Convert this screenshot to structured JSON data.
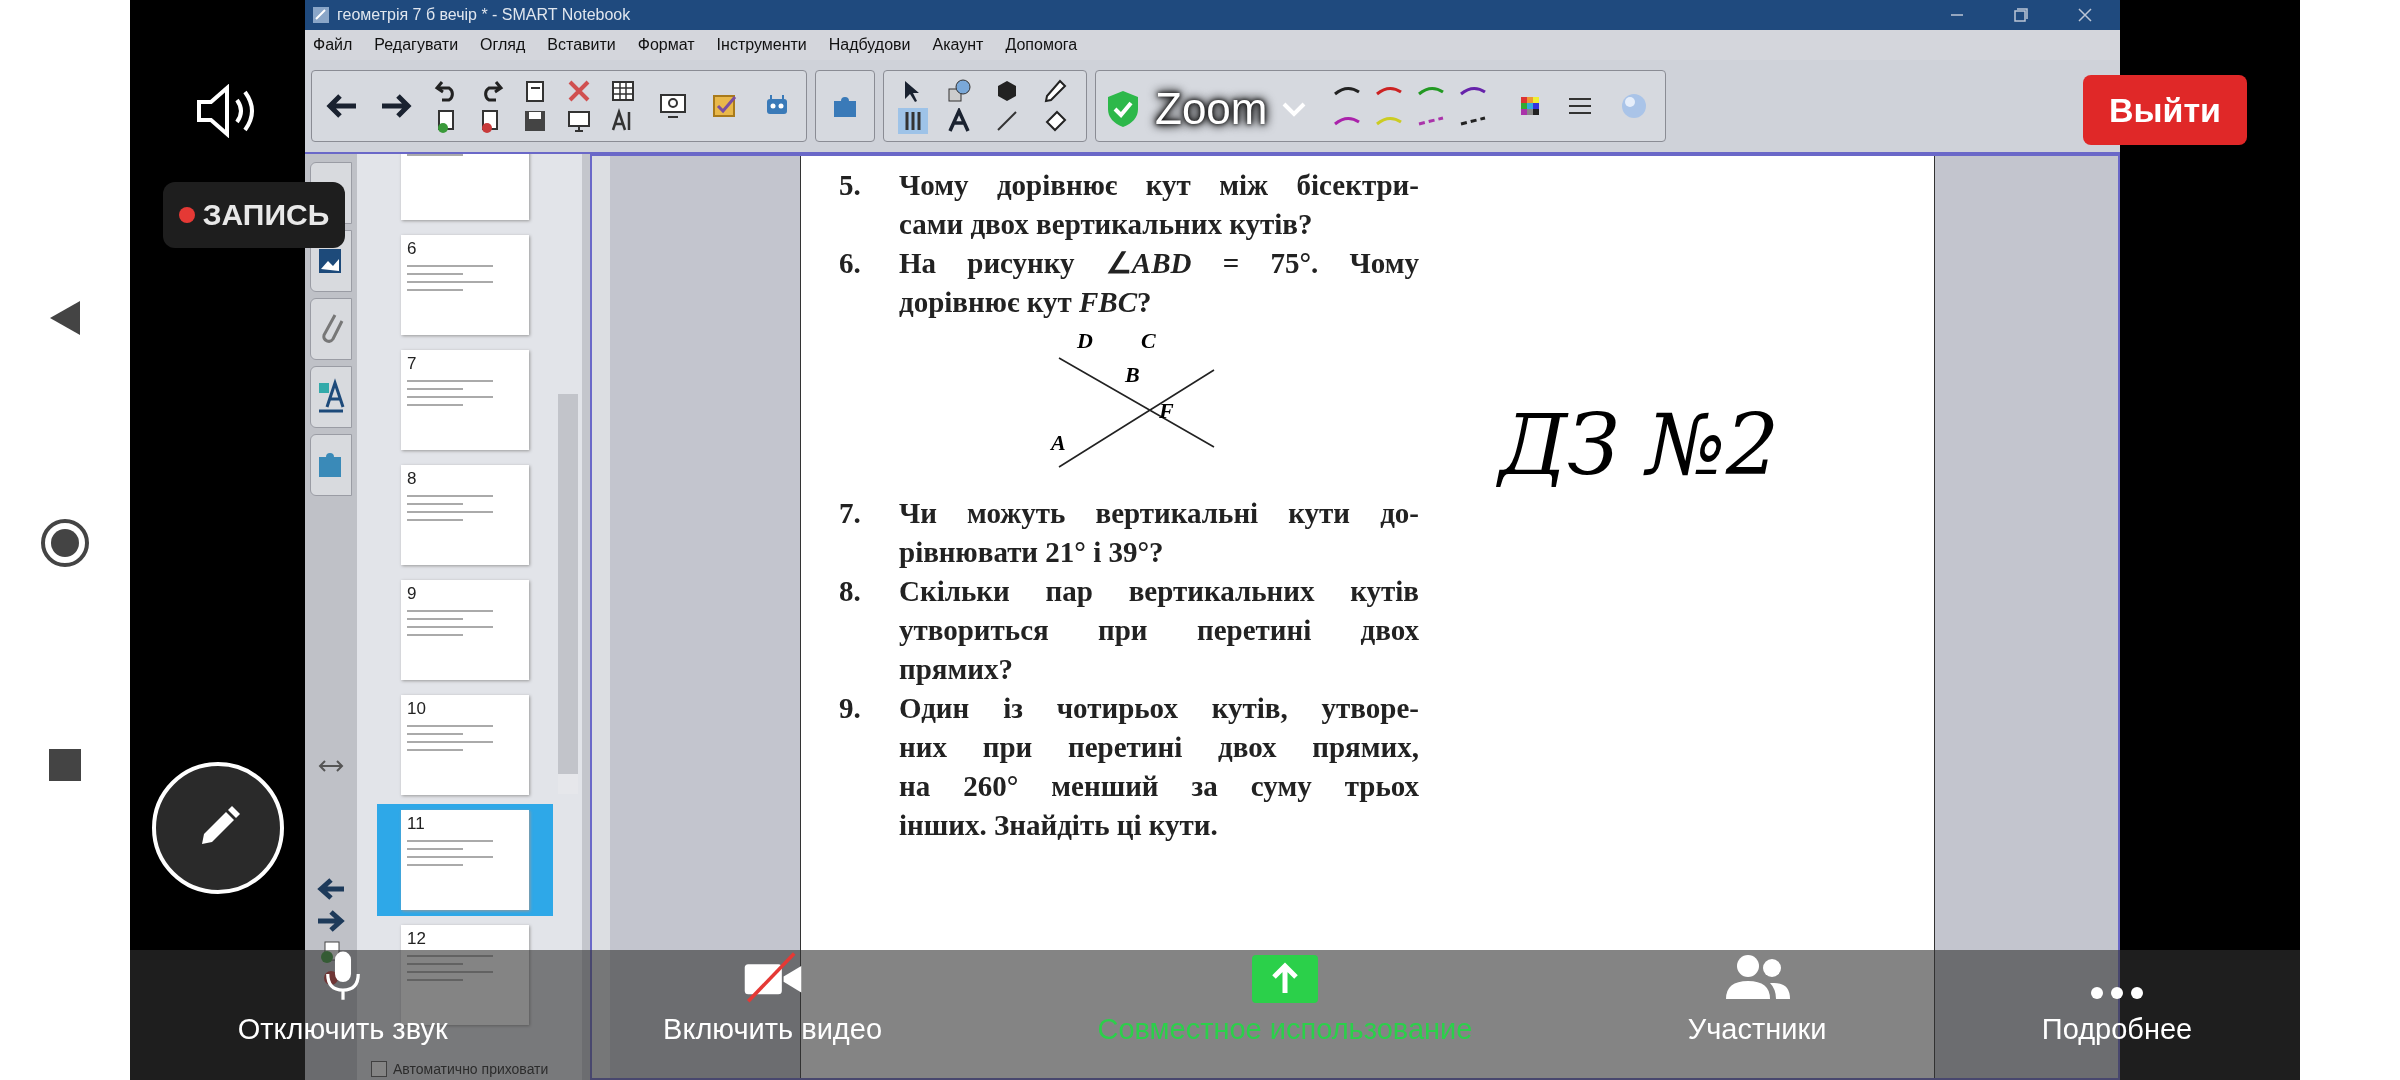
{
  "window": {
    "title": "геометрія 7 б вечір * - SMART Notebook"
  },
  "menu": [
    "Файл",
    "Редагувати",
    "Огляд",
    "Вставити",
    "Формат",
    "Інструменти",
    "Надбудови",
    "Акаунт",
    "Допомога"
  ],
  "page_sorter": {
    "pages": [
      {
        "selected": false
      },
      {
        "number": "6",
        "selected": false
      },
      {
        "number": "7",
        "selected": false
      },
      {
        "number": "8",
        "selected": false
      },
      {
        "number": "9",
        "selected": false
      },
      {
        "number": "10",
        "selected": false
      },
      {
        "number": "11",
        "selected": true
      },
      {
        "number": "12",
        "selected": false
      }
    ],
    "auto_hide": {
      "label": "Автоматично приховати",
      "checked": false
    }
  },
  "page": {
    "questions": [
      {
        "number": "5.",
        "lines": [
          "Чому дорівнює кут між бісектри-",
          "сами двох вертикальних кутів?"
        ]
      },
      {
        "number": "6.",
        "lines": [
          "На рисунку ∠*ABD* = 75°. Чому",
          "дорівнює кут *FBC*?"
        ],
        "figure": {
          "labels": [
            "D",
            "C",
            "B",
            "F",
            "A"
          ]
        }
      },
      {
        "number": "7.",
        "lines": [
          "Чи можуть вертикальні кути до-",
          "рівнювати 21° і 39°?"
        ]
      },
      {
        "number": "8.",
        "lines": [
          "Скільки пар вертикальних кутів",
          "утвориться при перетині двох",
          "прямих?"
        ]
      },
      {
        "number": "9.",
        "lines": [
          "Один із чотирьох кутів, утворе-",
          "них при перетині двох прямих,",
          "на 260° менший за суму трьох",
          "інших. Знайдіть ці кути."
        ]
      }
    ],
    "handwriting": "ДЗ №2"
  },
  "zoom": {
    "title": "Zoom",
    "recording": "ЗАПИСЬ",
    "leave": "Выйти",
    "toolbar": [
      {
        "kind": "mic",
        "label": "Отключить звук"
      },
      {
        "kind": "video-off",
        "label": "Включить видео"
      },
      {
        "kind": "share",
        "label": "Совместное использование"
      },
      {
        "kind": "participants",
        "label": "Участники"
      },
      {
        "kind": "more",
        "label": "Подробнее"
      }
    ]
  }
}
